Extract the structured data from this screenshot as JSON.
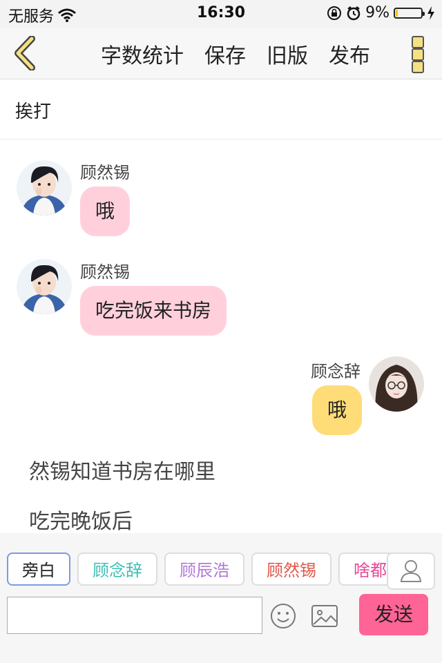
{
  "status_bar": {
    "carrier": "无服务",
    "time": "16:30",
    "battery": "9%"
  },
  "toolbar": {
    "actions": [
      "字数统计",
      "保存",
      "旧版",
      "发布"
    ],
    "accent": "#f4e183"
  },
  "chapter": {
    "title": "挨打"
  },
  "messages": [
    {
      "speaker": "顾然锡",
      "text": "哦",
      "side": "left",
      "bubble_color": "#ffd0dc"
    },
    {
      "speaker": "顾然锡",
      "text": "吃完饭来书房",
      "side": "left",
      "bubble_color": "#ffd0dc"
    },
    {
      "speaker": "顾念辞",
      "text": "哦",
      "side": "right",
      "bubble_color": "#fedc78"
    }
  ],
  "narrations": [
    "然锡知道书房在哪里",
    "吃完晚饭后"
  ],
  "characters": [
    {
      "label": "旁白",
      "color": "#222222",
      "active": true
    },
    {
      "label": "顾念辞",
      "color": "#3bbfb5"
    },
    {
      "label": "顾辰浩",
      "color": "#b07ad6"
    },
    {
      "label": "顾然锡",
      "color": "#e0564a"
    },
    {
      "label": "啥都",
      "color": "#e34a93"
    }
  ],
  "composer": {
    "input_value": "",
    "send_label": "发送",
    "send_color": "#ff6497"
  },
  "icons": [
    "back-chevron-icon",
    "more-icon",
    "person-icon",
    "emoji-icon",
    "image-icon",
    "wifi-icon",
    "lock-icon",
    "alarm-icon",
    "charging-icon"
  ]
}
